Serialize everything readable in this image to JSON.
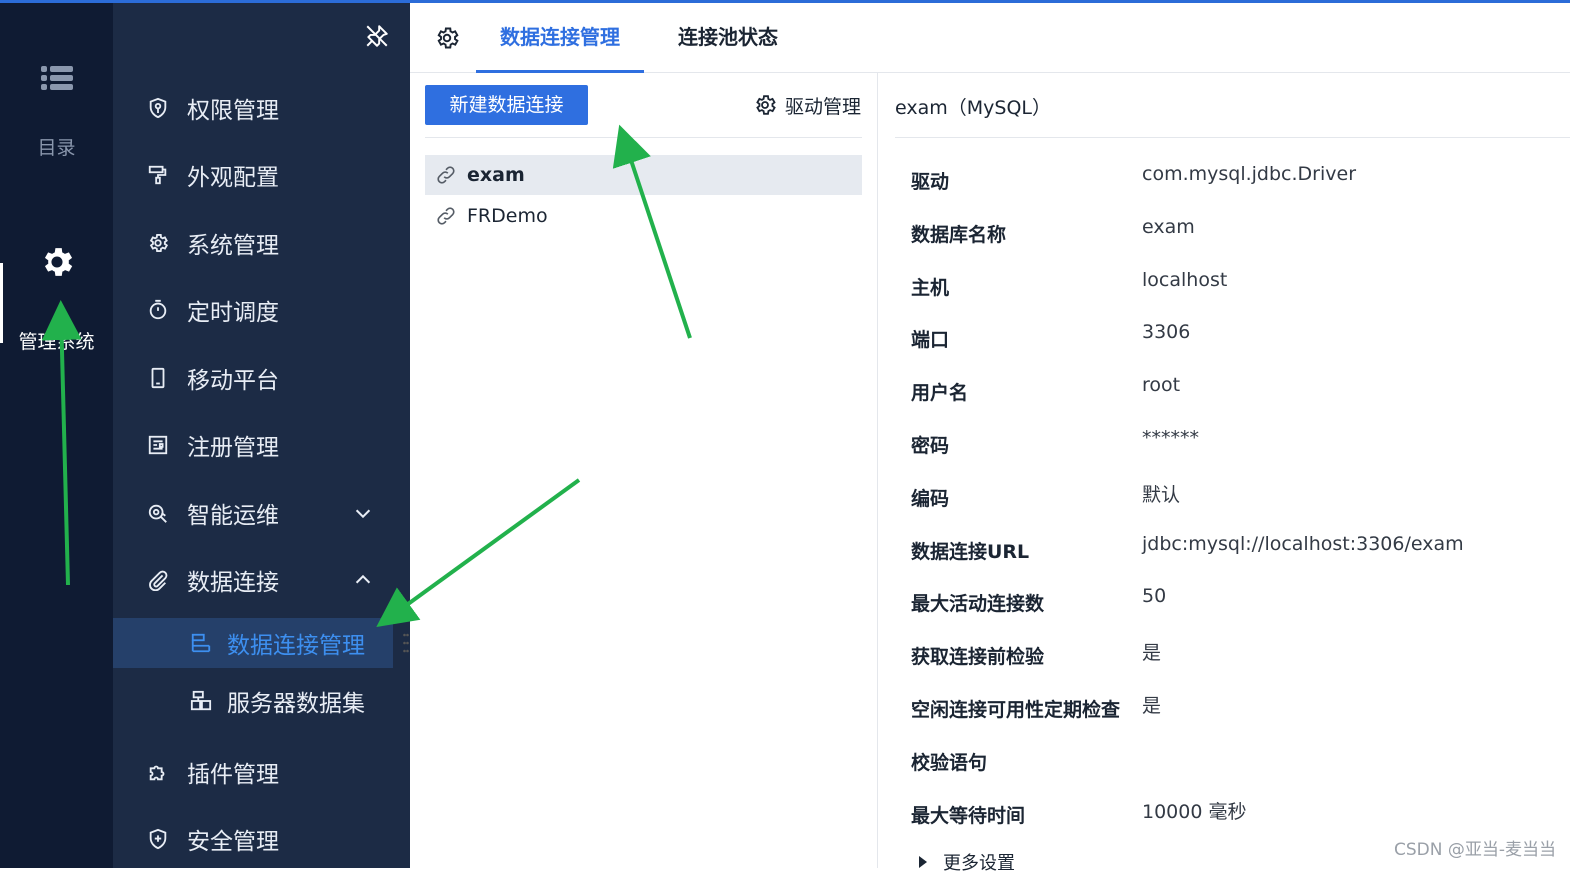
{
  "rail": {
    "items": [
      {
        "label": "目录",
        "icon": "list-icon"
      },
      {
        "label": "管理系统",
        "icon": "gear-icon"
      }
    ]
  },
  "menu": {
    "items": [
      {
        "label": "权限管理",
        "icon": "shield-key-icon"
      },
      {
        "label": "外观配置",
        "icon": "paint-roller-icon"
      },
      {
        "label": "系统管理",
        "icon": "gear-icon"
      },
      {
        "label": "定时调度",
        "icon": "stopwatch-icon"
      },
      {
        "label": "移动平台",
        "icon": "mobile-icon"
      },
      {
        "label": "注册管理",
        "icon": "register-icon"
      },
      {
        "label": "智能运维",
        "icon": "ops-icon"
      },
      {
        "label": "数据连接",
        "icon": "paperclip-icon"
      },
      {
        "label": "插件管理",
        "icon": "puzzle-icon"
      },
      {
        "label": "安全管理",
        "icon": "shield-plus-icon"
      }
    ],
    "sub_items": [
      {
        "label": "数据连接管理",
        "icon": "database-list-icon"
      },
      {
        "label": "服务器数据集",
        "icon": "server-dataset-icon"
      }
    ]
  },
  "tabs": [
    {
      "label": "数据连接管理"
    },
    {
      "label": "连接池状态"
    }
  ],
  "list": {
    "new_button": "新建数据连接",
    "driver_mgmt": "驱动管理",
    "connections": [
      "exam",
      "FRDemo"
    ]
  },
  "detail": {
    "title": "exam（MySQL）",
    "fields": [
      {
        "key": "驱动",
        "value": "com.mysql.jdbc.Driver"
      },
      {
        "key": "数据库名称",
        "value": "exam"
      },
      {
        "key": "主机",
        "value": "localhost"
      },
      {
        "key": "端口",
        "value": "3306"
      },
      {
        "key": "用户名",
        "value": "root"
      },
      {
        "key": "密码",
        "value": "******"
      },
      {
        "key": "编码",
        "value": "默认"
      },
      {
        "key": "数据连接URL",
        "value": "jdbc:mysql://localhost:3306/exam"
      },
      {
        "key": "最大活动连接数",
        "value": "50"
      },
      {
        "key": "获取连接前检验",
        "value": "是"
      },
      {
        "key": "空闲连接可用性定期检查",
        "value": "是"
      },
      {
        "key": "校验语句",
        "value": ""
      },
      {
        "key": "最大等待时间",
        "value": "10000 毫秒"
      }
    ],
    "more": "更多设置"
  },
  "watermark": "CSDN @亚当-麦当当",
  "colors": {
    "accent": "#2f6fe0",
    "rail_bg": "#0f1b33",
    "menu_bg": "#1c2b45",
    "active_sub_bg": "#25406a",
    "annotation_arrow": "#22b14c"
  }
}
